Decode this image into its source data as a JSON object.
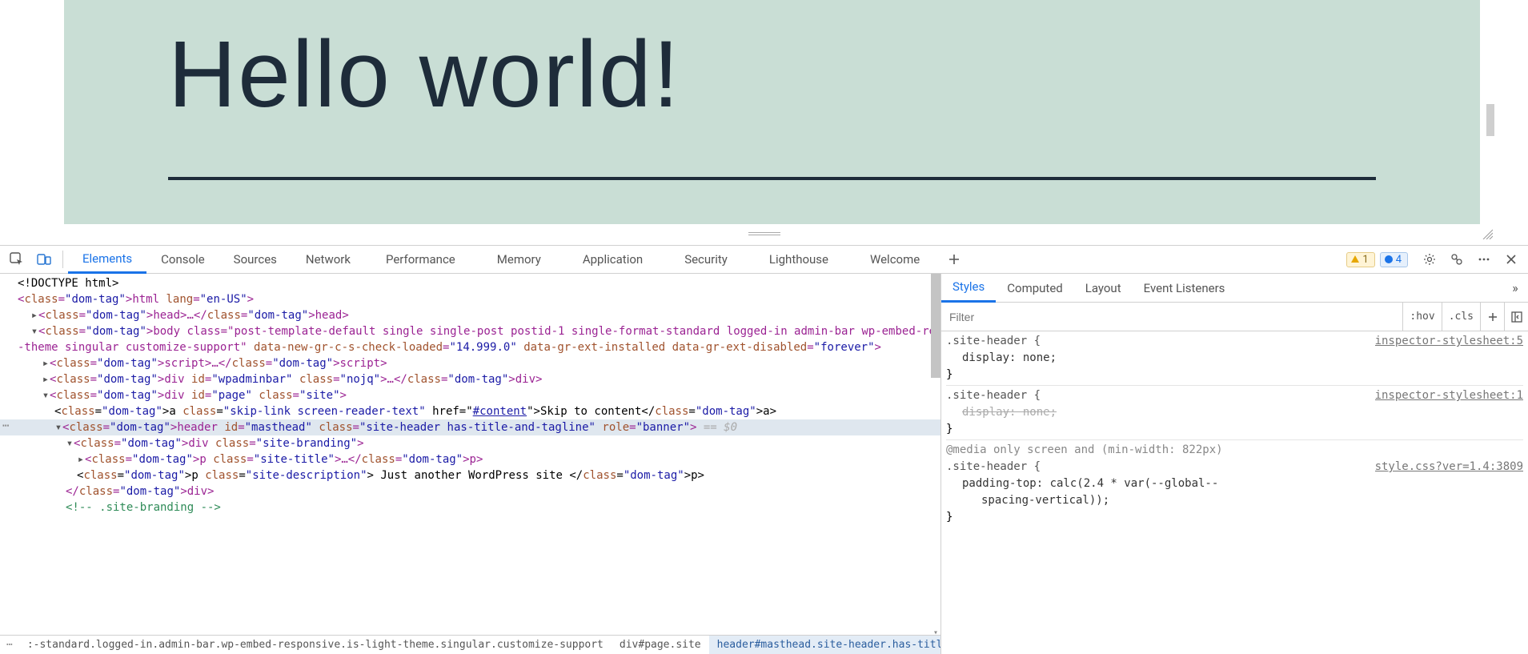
{
  "preview": {
    "title": "Hello world!"
  },
  "devtools": {
    "tabs": [
      "Elements",
      "Console",
      "Sources",
      "Network",
      "Performance",
      "Memory",
      "Application",
      "Security",
      "Lighthouse",
      "Welcome"
    ],
    "warnings": "1",
    "infos": "4"
  },
  "dom": {
    "doctype": "<!DOCTYPE html>",
    "html_open": "<html lang=\"en-US\">",
    "head": "<head>…</head>",
    "body_open_a": "<body class=\"post-template-default single single-post postid-1 single-format-standard logged-in admin-bar wp-embed-responsive is-light",
    "body_open_b": "-theme singular customize-support\" data-new-gr-c-s-check-loaded=\"14.999.0\" data-gr-ext-installed data-gr-ext-disabled=\"forever\">",
    "script": "<script>…</script>",
    "wpadminbar": "<div id=\"wpadminbar\" class=\"nojq\">…</div>",
    "page_div": "<div id=\"page\" class=\"site\">",
    "skiplink_pre": "<a class=\"skip-link screen-reader-text\" href=\"",
    "skiplink_href": "#content",
    "skiplink_text": "Skip to content",
    "skiplink_close": "</a>",
    "header": "<header id=\"masthead\" class=\"site-header has-title-and-tagline\" role=\"banner\">",
    "eq0": "== $0",
    "branding": "<div class=\"site-branding\">",
    "site_title": "<p class=\"site-title\">…</p>",
    "site_desc_open": "<p class=\"site-description\">",
    "site_desc_text": " Just another WordPress site ",
    "site_desc_close": "</p>",
    "div_close": "</div>",
    "branding_comment": "<!-- .site-branding -->"
  },
  "breadcrumb": {
    "truncated": ":-standard.logged-in.admin-bar.wp-embed-responsive.is-light-theme.singular.customize-support",
    "page": "div#page.site",
    "header": "header#masthead.site-header.has-title-and-tagline"
  },
  "styles": {
    "subtabs": [
      "Styles",
      "Computed",
      "Layout",
      "Event Listeners"
    ],
    "filter_placeholder": "Filter",
    "hov": ":hov",
    "cls": ".cls",
    "rule1": {
      "selector": ".site-header {",
      "link": "inspector-stylesheet:5",
      "prop": "display: none;"
    },
    "rule2": {
      "selector": ".site-header {",
      "link": "inspector-stylesheet:1",
      "prop": "display: none;"
    },
    "rule3": {
      "media": "@media only screen and (min-width: 822px)",
      "selector": ".site-header {",
      "link": "style.css?ver=1.4:3809",
      "prop_a": "padding-top: calc(2.4 * var(--global--",
      "prop_b": "spacing-vertical));"
    }
  }
}
